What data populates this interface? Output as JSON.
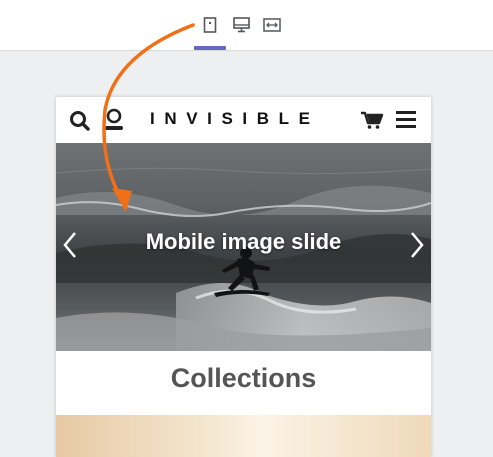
{
  "toolbar": {
    "devices": [
      {
        "icon": "mobile-icon",
        "active": true
      },
      {
        "icon": "desktop-icon",
        "active": false
      },
      {
        "icon": "fullwidth-icon",
        "active": false
      }
    ],
    "accent_color": "#6468c0"
  },
  "preview": {
    "header": {
      "brand": "INVISIBLE",
      "icons": [
        "search-icon",
        "account-icon",
        "cart-icon",
        "menu-icon"
      ]
    },
    "slide": {
      "caption": "Mobile image slide",
      "prev_icon": "chevron-left-icon",
      "next_icon": "chevron-right-icon"
    },
    "collections_title": "Collections"
  },
  "annotation": {
    "color": "#f07018"
  }
}
